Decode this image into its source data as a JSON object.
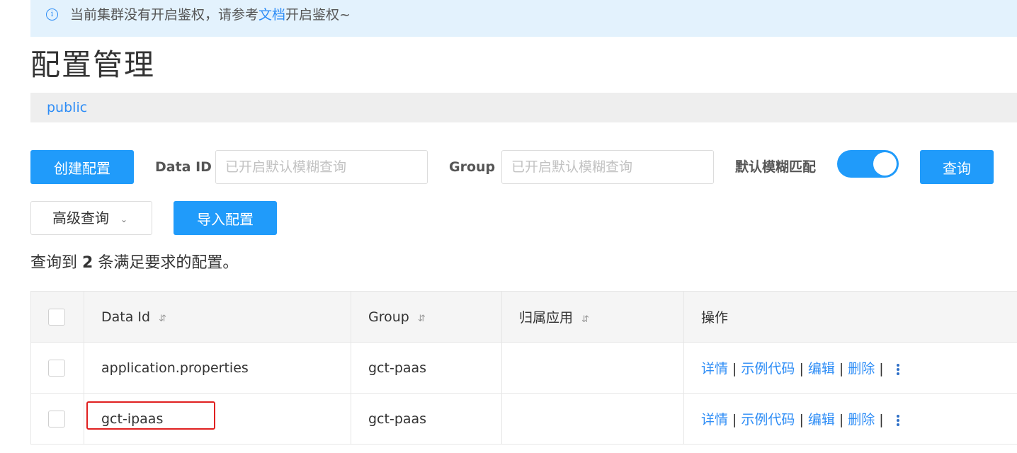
{
  "notice": {
    "prefix": "当前集群没有开启鉴权，请参考",
    "link": "文档",
    "suffix": "开启鉴权~"
  },
  "page": {
    "title": "配置管理"
  },
  "namespace": {
    "name": "public"
  },
  "toolbar": {
    "create_label": "创建配置",
    "data_id_label": "Data ID",
    "data_id_placeholder": "已开启默认模糊查询",
    "group_label": "Group",
    "group_placeholder": "已开启默认模糊查询",
    "fuzzy_label": "默认模糊匹配",
    "fuzzy_on": true,
    "query_label": "查询",
    "advanced_label": "高级查询",
    "import_label": "导入配置"
  },
  "result": {
    "prefix": "查询到",
    "count": "2",
    "suffix": "条满足要求的配置。"
  },
  "table": {
    "headers": [
      "Data Id",
      "Group",
      "归属应用",
      "操作"
    ],
    "rows": [
      {
        "data_id": "application.properties",
        "group": "gct-paas",
        "app": ""
      },
      {
        "data_id": "gct-ipaas",
        "group": "gct-paas",
        "app": ""
      }
    ],
    "actions": {
      "detail": "详情",
      "sample": "示例代码",
      "edit": "编辑",
      "delete": "删除",
      "sep": "|"
    }
  },
  "colors": {
    "primary": "#209bfa",
    "link": "#2e8df6",
    "highlight": "#e02020"
  }
}
